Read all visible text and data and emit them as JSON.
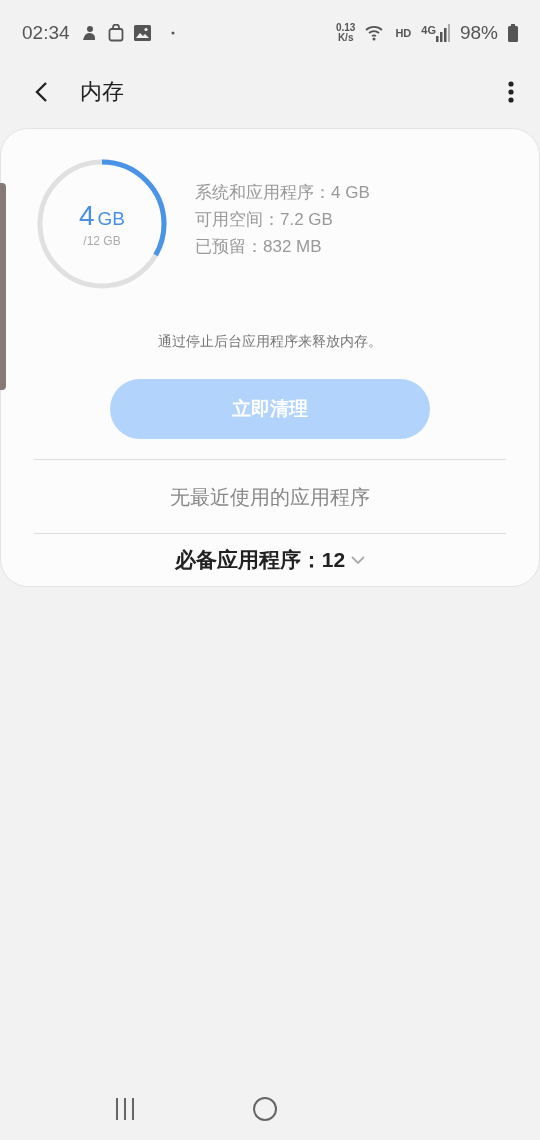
{
  "status_bar": {
    "time": "02:34",
    "net_speed": "0.13",
    "net_unit": "K/s",
    "hd": "HD",
    "network": "4G",
    "battery": "98%"
  },
  "header": {
    "title": "内存"
  },
  "memory": {
    "used": "4",
    "used_unit": "GB",
    "total": "/12 GB",
    "level": 0.333,
    "details": [
      "系统和应用程序：4 GB",
      "可用空间：7.2 GB",
      "已预留：832 MB"
    ]
  },
  "hint": "通过停止后台应用程序来释放内存。",
  "clean_button": {
    "label": "立即清理",
    "disabled": true
  },
  "recent_apps": "无最近使用的应用程序",
  "essential_apps": {
    "label": "必备应用程序：12",
    "expanded": false
  }
}
